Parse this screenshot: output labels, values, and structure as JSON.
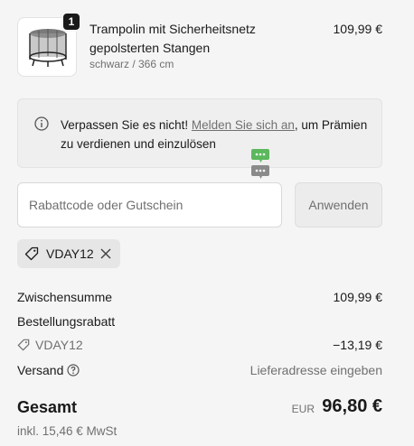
{
  "cart": {
    "item": {
      "quantity": "1",
      "name": "Trampolin mit Sicherheitsnetz gepolsterten Stangen",
      "variant": "schwarz / 366 cm",
      "price": "109,99 €"
    }
  },
  "notice": {
    "text_before": "Verpassen Sie es nicht! ",
    "link": "Melden Sie sich an",
    "text_after": ", um Prämien zu verdienen und einzulösen"
  },
  "discount": {
    "placeholder": "Rabattcode oder Gutschein",
    "value": "",
    "apply_label": "Anwenden",
    "applied_code": "VDAY12"
  },
  "summary": {
    "subtotal_label": "Zwischensumme",
    "subtotal_value": "109,99 €",
    "order_discount_label": "Bestellungsrabatt",
    "discount_code": "VDAY12",
    "discount_value": "−13,19 €",
    "shipping_label": "Versand",
    "shipping_value": "Lieferadresse eingeben",
    "total_label": "Gesamt",
    "total_currency": "EUR",
    "total_value": "96,80 €",
    "tax_note": "inkl. 15,46 € MwSt"
  },
  "icons": {
    "info": "info-icon",
    "tag": "tag-icon",
    "close": "close-icon",
    "help": "help-icon",
    "chat": "chat-bubble-icon"
  },
  "colors": {
    "background": "#f5f5f5",
    "text": "#1a1a1a",
    "muted": "#707070",
    "chat_green": "#5cb85c",
    "chat_gray": "#8a8a8a"
  }
}
